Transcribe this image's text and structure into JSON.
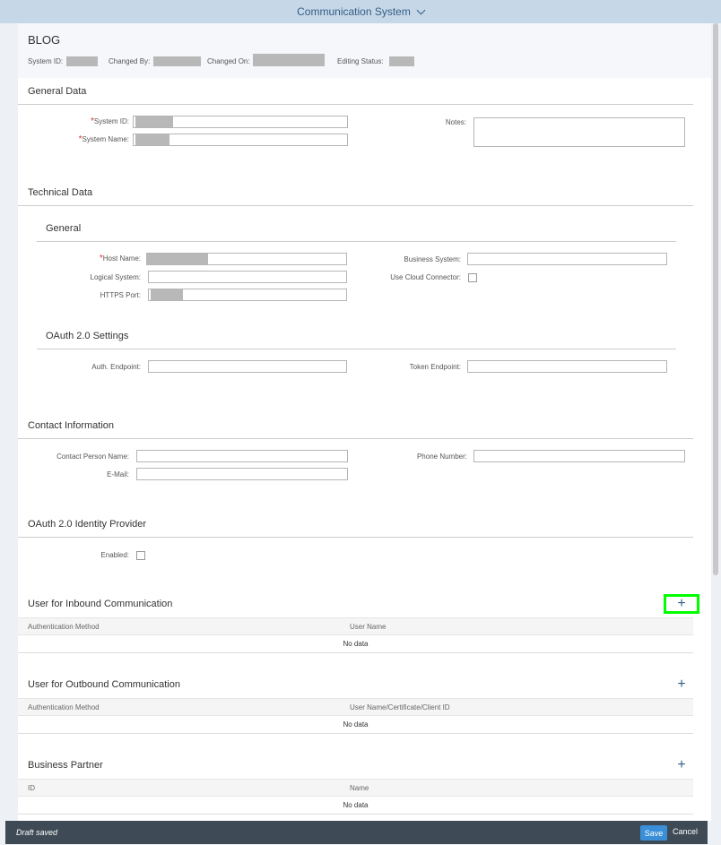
{
  "shell": {
    "title": "Communication System"
  },
  "header": {
    "title": "BLOG",
    "system_id_label": "System ID:",
    "changed_by_label": "Changed By:",
    "changed_on_label": "Changed On:",
    "editing_status_label": "Editing Status:"
  },
  "general_data": {
    "title": "General Data",
    "system_id_label": "System ID:",
    "system_name_label": "System Name:",
    "notes_label": "Notes:"
  },
  "technical_data": {
    "title": "Technical Data",
    "general": {
      "title": "General",
      "host_name_label": "Host Name:",
      "logical_system_label": "Logical System:",
      "https_port_label": "HTTPS Port:",
      "business_system_label": "Business System:",
      "use_cloud_connector_label": "Use Cloud Connector:"
    },
    "oauth": {
      "title": "OAuth 2.0 Settings",
      "auth_endpoint_label": "Auth. Endpoint:",
      "token_endpoint_label": "Token Endpoint:"
    }
  },
  "contact_information": {
    "title": "Contact Information",
    "contact_person_label": "Contact Person Name:",
    "email_label": "E-Mail:",
    "phone_label": "Phone Number:"
  },
  "oauth_idp": {
    "title": "OAuth 2.0 Identity Provider",
    "enabled_label": "Enabled:"
  },
  "inbound": {
    "title": "User for Inbound Communication",
    "add_label": "+",
    "columns": [
      "Authentication Method",
      "User Name"
    ],
    "no_data": "No data"
  },
  "outbound": {
    "title": "User for Outbound Communication",
    "add_label": "+",
    "columns": [
      "Authentication Method",
      "User Name/Certificate/Client ID"
    ],
    "no_data": "No data"
  },
  "business_partner": {
    "title": "Business Partner",
    "add_label": "+",
    "columns": [
      "ID",
      "Name"
    ],
    "no_data": "No data"
  },
  "footer": {
    "status": "Draft saved",
    "save_label": "Save",
    "cancel_label": "Cancel"
  }
}
